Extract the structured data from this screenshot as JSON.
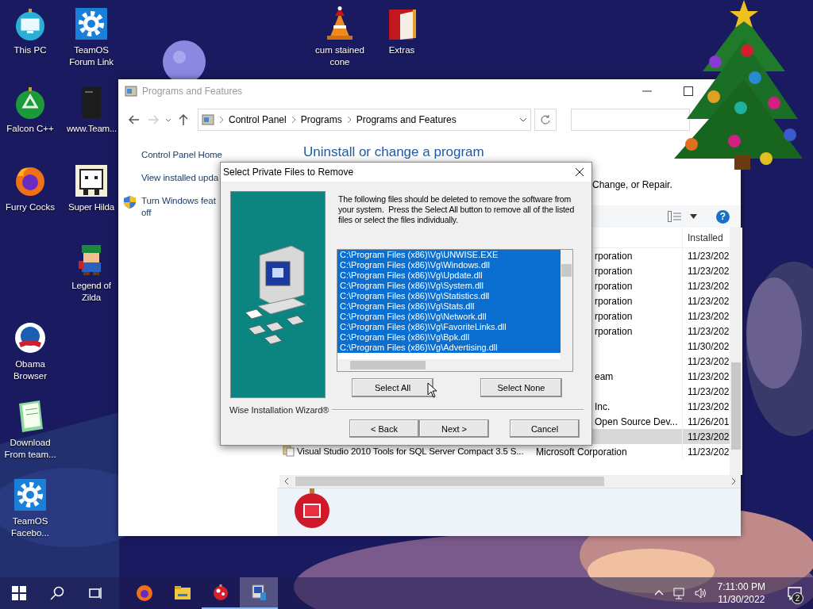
{
  "desktop_icons": [
    {
      "label": "This PC",
      "kind": "pc"
    },
    {
      "label": "TeamOS Forum Link",
      "kind": "gear"
    },
    {
      "label": "cum stained cone",
      "kind": "cone"
    },
    {
      "label": "Extras",
      "kind": "book"
    },
    {
      "label": "Falcon C++",
      "kind": "recycle"
    },
    {
      "label": "www.Team...",
      "kind": "file"
    },
    {
      "label": "Furry Cocks",
      "kind": "firefox"
    },
    {
      "label": "Super Hilda",
      "kind": "dog"
    },
    {
      "label": "Legend of Zilda",
      "kind": "character"
    },
    {
      "label": "Obama Browser",
      "kind": "logo"
    },
    {
      "label": "Download From team...",
      "kind": "notepad"
    },
    {
      "label": "TeamOS Facebo...",
      "kind": "gear"
    }
  ],
  "window": {
    "title": "Programs and Features",
    "address": [
      "Control Panel",
      "Programs",
      "Programs and Features"
    ],
    "sidebar": [
      {
        "kind": "link",
        "lines": [
          "Control Panel Home"
        ]
      },
      {
        "kind": "link",
        "lines": [
          "View installed upda"
        ]
      },
      {
        "kind": "shield-link",
        "lines": [
          "Turn Windows feat",
          "off"
        ]
      }
    ],
    "heading": "Uninstall or change a program",
    "instructions": "Change, or Repair.",
    "help": "?",
    "table": {
      "columns": [
        "Installed"
      ],
      "rows": [
        {
          "publisher": "rporation",
          "installed": "11/23/202",
          "selected": false
        },
        {
          "publisher": "rporation",
          "installed": "11/23/202",
          "selected": false
        },
        {
          "publisher": "rporation",
          "installed": "11/23/202",
          "selected": false
        },
        {
          "publisher": "rporation",
          "installed": "11/23/202",
          "selected": false
        },
        {
          "publisher": "rporation",
          "installed": "11/23/202",
          "selected": false
        },
        {
          "publisher": "rporation",
          "installed": "11/23/202",
          "selected": false
        },
        {
          "installed": "11/30/202",
          "selected": false
        },
        {
          "installed": "11/23/202",
          "selected": false
        },
        {
          "publisher": "eam",
          "installed": "11/23/202",
          "selected": false
        },
        {
          "installed": "11/23/202",
          "selected": false
        },
        {
          "publisher": "Inc.",
          "installed": "11/23/202",
          "selected": false
        },
        {
          "publisher": "Open Source Dev...",
          "installed": "11/26/201",
          "selected": false
        },
        {
          "installed": "11/23/202",
          "selected": true
        },
        {
          "name": "Visual Studio 2010 Tools for SQL Server Compact 3.5 S...",
          "publisher": "Microsoft Corporation",
          "installed": "11/23/202",
          "selected": false
        }
      ]
    }
  },
  "dialog": {
    "title": "Select Private Files to Remove",
    "message": "The following files should be deleted to remove the software from your system.  Press the Select All button to remove all of the listed files or select the files individually.",
    "files": [
      {
        "path": "C:\\Program Files (x86)\\Vg\\UNWISE.EXE",
        "selected": true
      },
      {
        "path": "C:\\Program Files (x86)\\Vg\\Windows.dll",
        "selected": true
      },
      {
        "path": "C:\\Program Files (x86)\\Vg\\Update.dll",
        "selected": true
      },
      {
        "path": "C:\\Program Files (x86)\\Vg\\System.dll",
        "selected": true
      },
      {
        "path": "C:\\Program Files (x86)\\Vg\\Statistics.dll",
        "selected": true
      },
      {
        "path": "C:\\Program Files (x86)\\Vg\\Stats.dll",
        "selected": true
      },
      {
        "path": "C:\\Program Files (x86)\\Vg\\Network.dll",
        "selected": true
      },
      {
        "path": "C:\\Program Files (x86)\\Vg\\FavoriteLinks.dll",
        "selected": true
      },
      {
        "path": "C:\\Program Files (x86)\\Vg\\Bpk.dll",
        "selected": true
      },
      {
        "path": "C:\\Program Files (x86)\\Vg\\Advertising.dll",
        "selected": true
      }
    ],
    "select_buttons": [
      "Select All",
      "Select None"
    ],
    "brand": "Wise Installation Wizard®",
    "nav_buttons": [
      "< Back",
      "Next >",
      "Cancel"
    ]
  },
  "taskbar": {
    "apps": [
      {
        "kind": "browser",
        "running": false,
        "selected": false
      },
      {
        "kind": "folder",
        "running": false,
        "selected": false
      },
      {
        "kind": "ornament",
        "running": true,
        "selected": false
      },
      {
        "kind": "installer",
        "running": true,
        "selected": true
      }
    ],
    "time": "7:11:00 PM",
    "date": "11/30/2022",
    "notifications": "2"
  }
}
